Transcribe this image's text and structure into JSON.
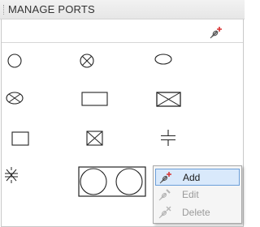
{
  "panel": {
    "title": "MANAGE PORTS"
  },
  "toolbar": {
    "add_port_icon": "port-add-icon"
  },
  "port_shapes": [
    {
      "shape": "circle"
    },
    {
      "shape": "circle-x"
    },
    {
      "shape": "ellipse"
    },
    {
      "shape": "ellipse-x"
    },
    {
      "shape": "rectangle"
    },
    {
      "shape": "rectangle-x"
    },
    {
      "shape": "square"
    },
    {
      "shape": "square-x"
    },
    {
      "shape": "parallel-lines"
    },
    {
      "shape": "bowtie"
    },
    {
      "shape": "double-circle-rectangle"
    }
  ],
  "context_menu": {
    "items": [
      {
        "label": "Add",
        "icon": "port-add-icon",
        "state": "highlighted"
      },
      {
        "label": "Edit",
        "icon": "port-edit-icon",
        "state": "disabled"
      },
      {
        "label": "Delete",
        "icon": "port-delete-icon",
        "state": "disabled"
      }
    ]
  },
  "colors": {
    "highlight_bg": "#d9e9fb",
    "highlight_border": "#6b9ed8",
    "accent_red": "#d83030"
  }
}
